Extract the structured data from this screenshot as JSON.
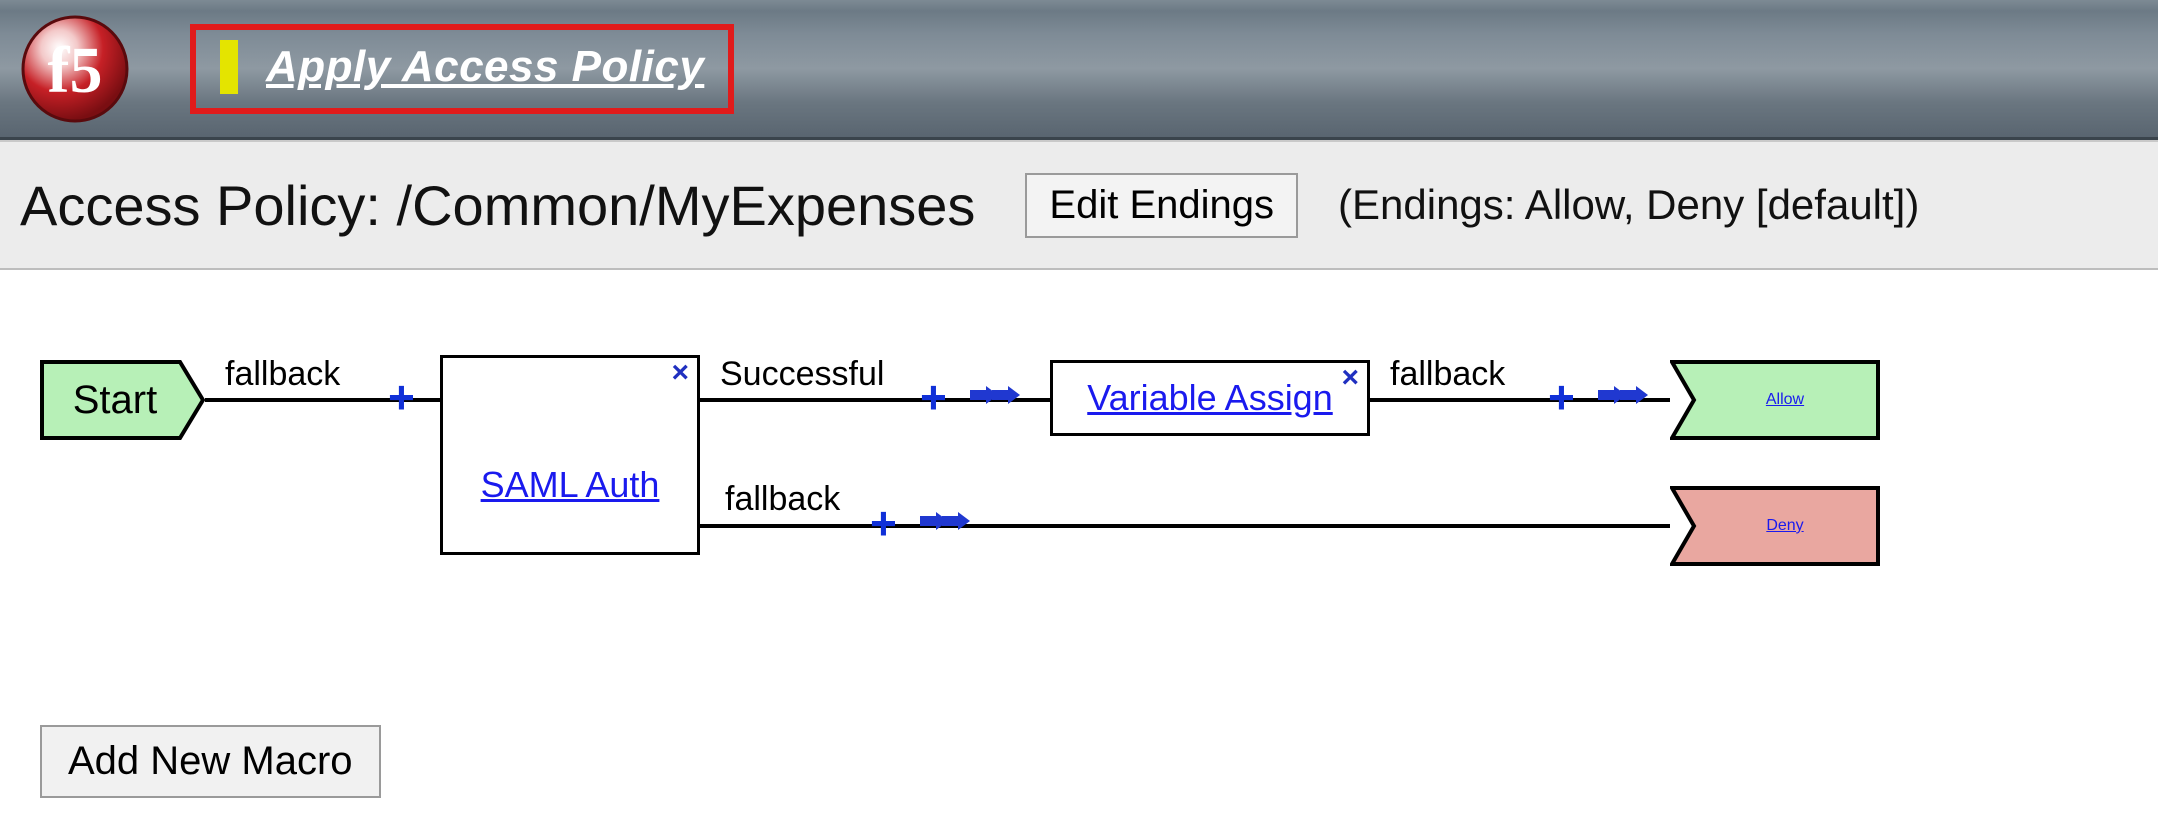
{
  "header": {
    "apply_label": "Apply Access Policy"
  },
  "subheader": {
    "title": "Access Policy: /Common/MyExpenses",
    "edit_endings_label": "Edit Endings",
    "endings_text": "(Endings: Allow, Deny [default])"
  },
  "diagram": {
    "start_label": "Start",
    "saml_auth_label": "SAML Auth",
    "variable_assign_label": "Variable Assign",
    "allow_label": "Allow",
    "deny_label": "Deny",
    "edge_start_fallback": "fallback",
    "edge_saml_success": "Successful",
    "edge_saml_fallback": "fallback",
    "edge_var_fallback": "fallback"
  },
  "buttons": {
    "add_macro_label": "Add New Macro"
  },
  "colors": {
    "start_fill": "#b7f0b7",
    "allow_fill": "#b7f0b7",
    "deny_fill": "#e9a7a0",
    "highlight_red": "#e11b1b",
    "link_blue": "#1a1aee"
  }
}
